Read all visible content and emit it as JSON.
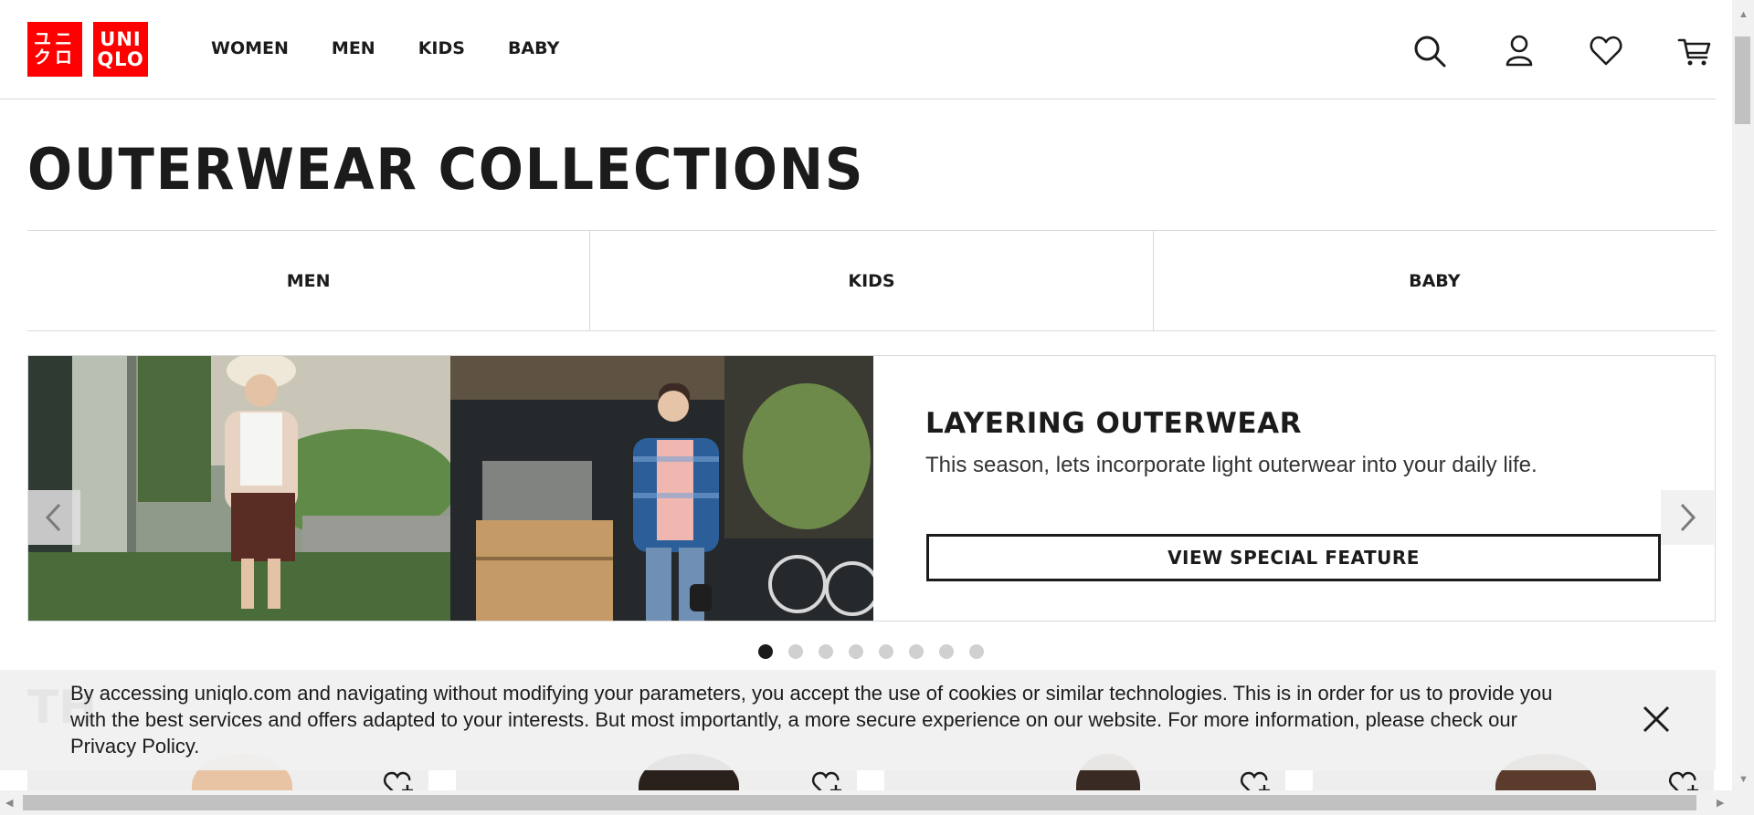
{
  "header": {
    "logo_jp": "ユニクロ",
    "logo_en": "UNIQLO",
    "nav": [
      "WOMEN",
      "MEN",
      "KIDS",
      "BABY"
    ],
    "icons": [
      "search-icon",
      "account-icon",
      "wishlist-heart-icon",
      "cart-icon"
    ]
  },
  "main": {
    "title": "OUTERWEAR COLLECTIONS",
    "category_tabs": [
      "MEN",
      "KIDS",
      "BABY"
    ]
  },
  "banner": {
    "heading": "LAYERING OUTERWEAR",
    "subtitle": "This season, lets incorporate light outerwear into your daily life.",
    "button_label": "VIEW SPECIAL FEATURE",
    "slide_count": 8,
    "active_slide": 1
  },
  "section_peek": {
    "title_fragment": "TH"
  },
  "cookie": {
    "text": "By accessing uniqlo.com and navigating without modifying your parameters, you accept the use of cookies or similar technologies. This is in order for us to provide you with the best services and offers adapted to your interests. But most importantly, a more secure experience on our website. For more information, please check our Privacy Policy."
  },
  "colors": {
    "brand_red": "#ff0000",
    "text_dark": "#1b1b1b",
    "dot_inactive": "#d0d0d0",
    "cookie_bg": "#f0f0f0"
  }
}
